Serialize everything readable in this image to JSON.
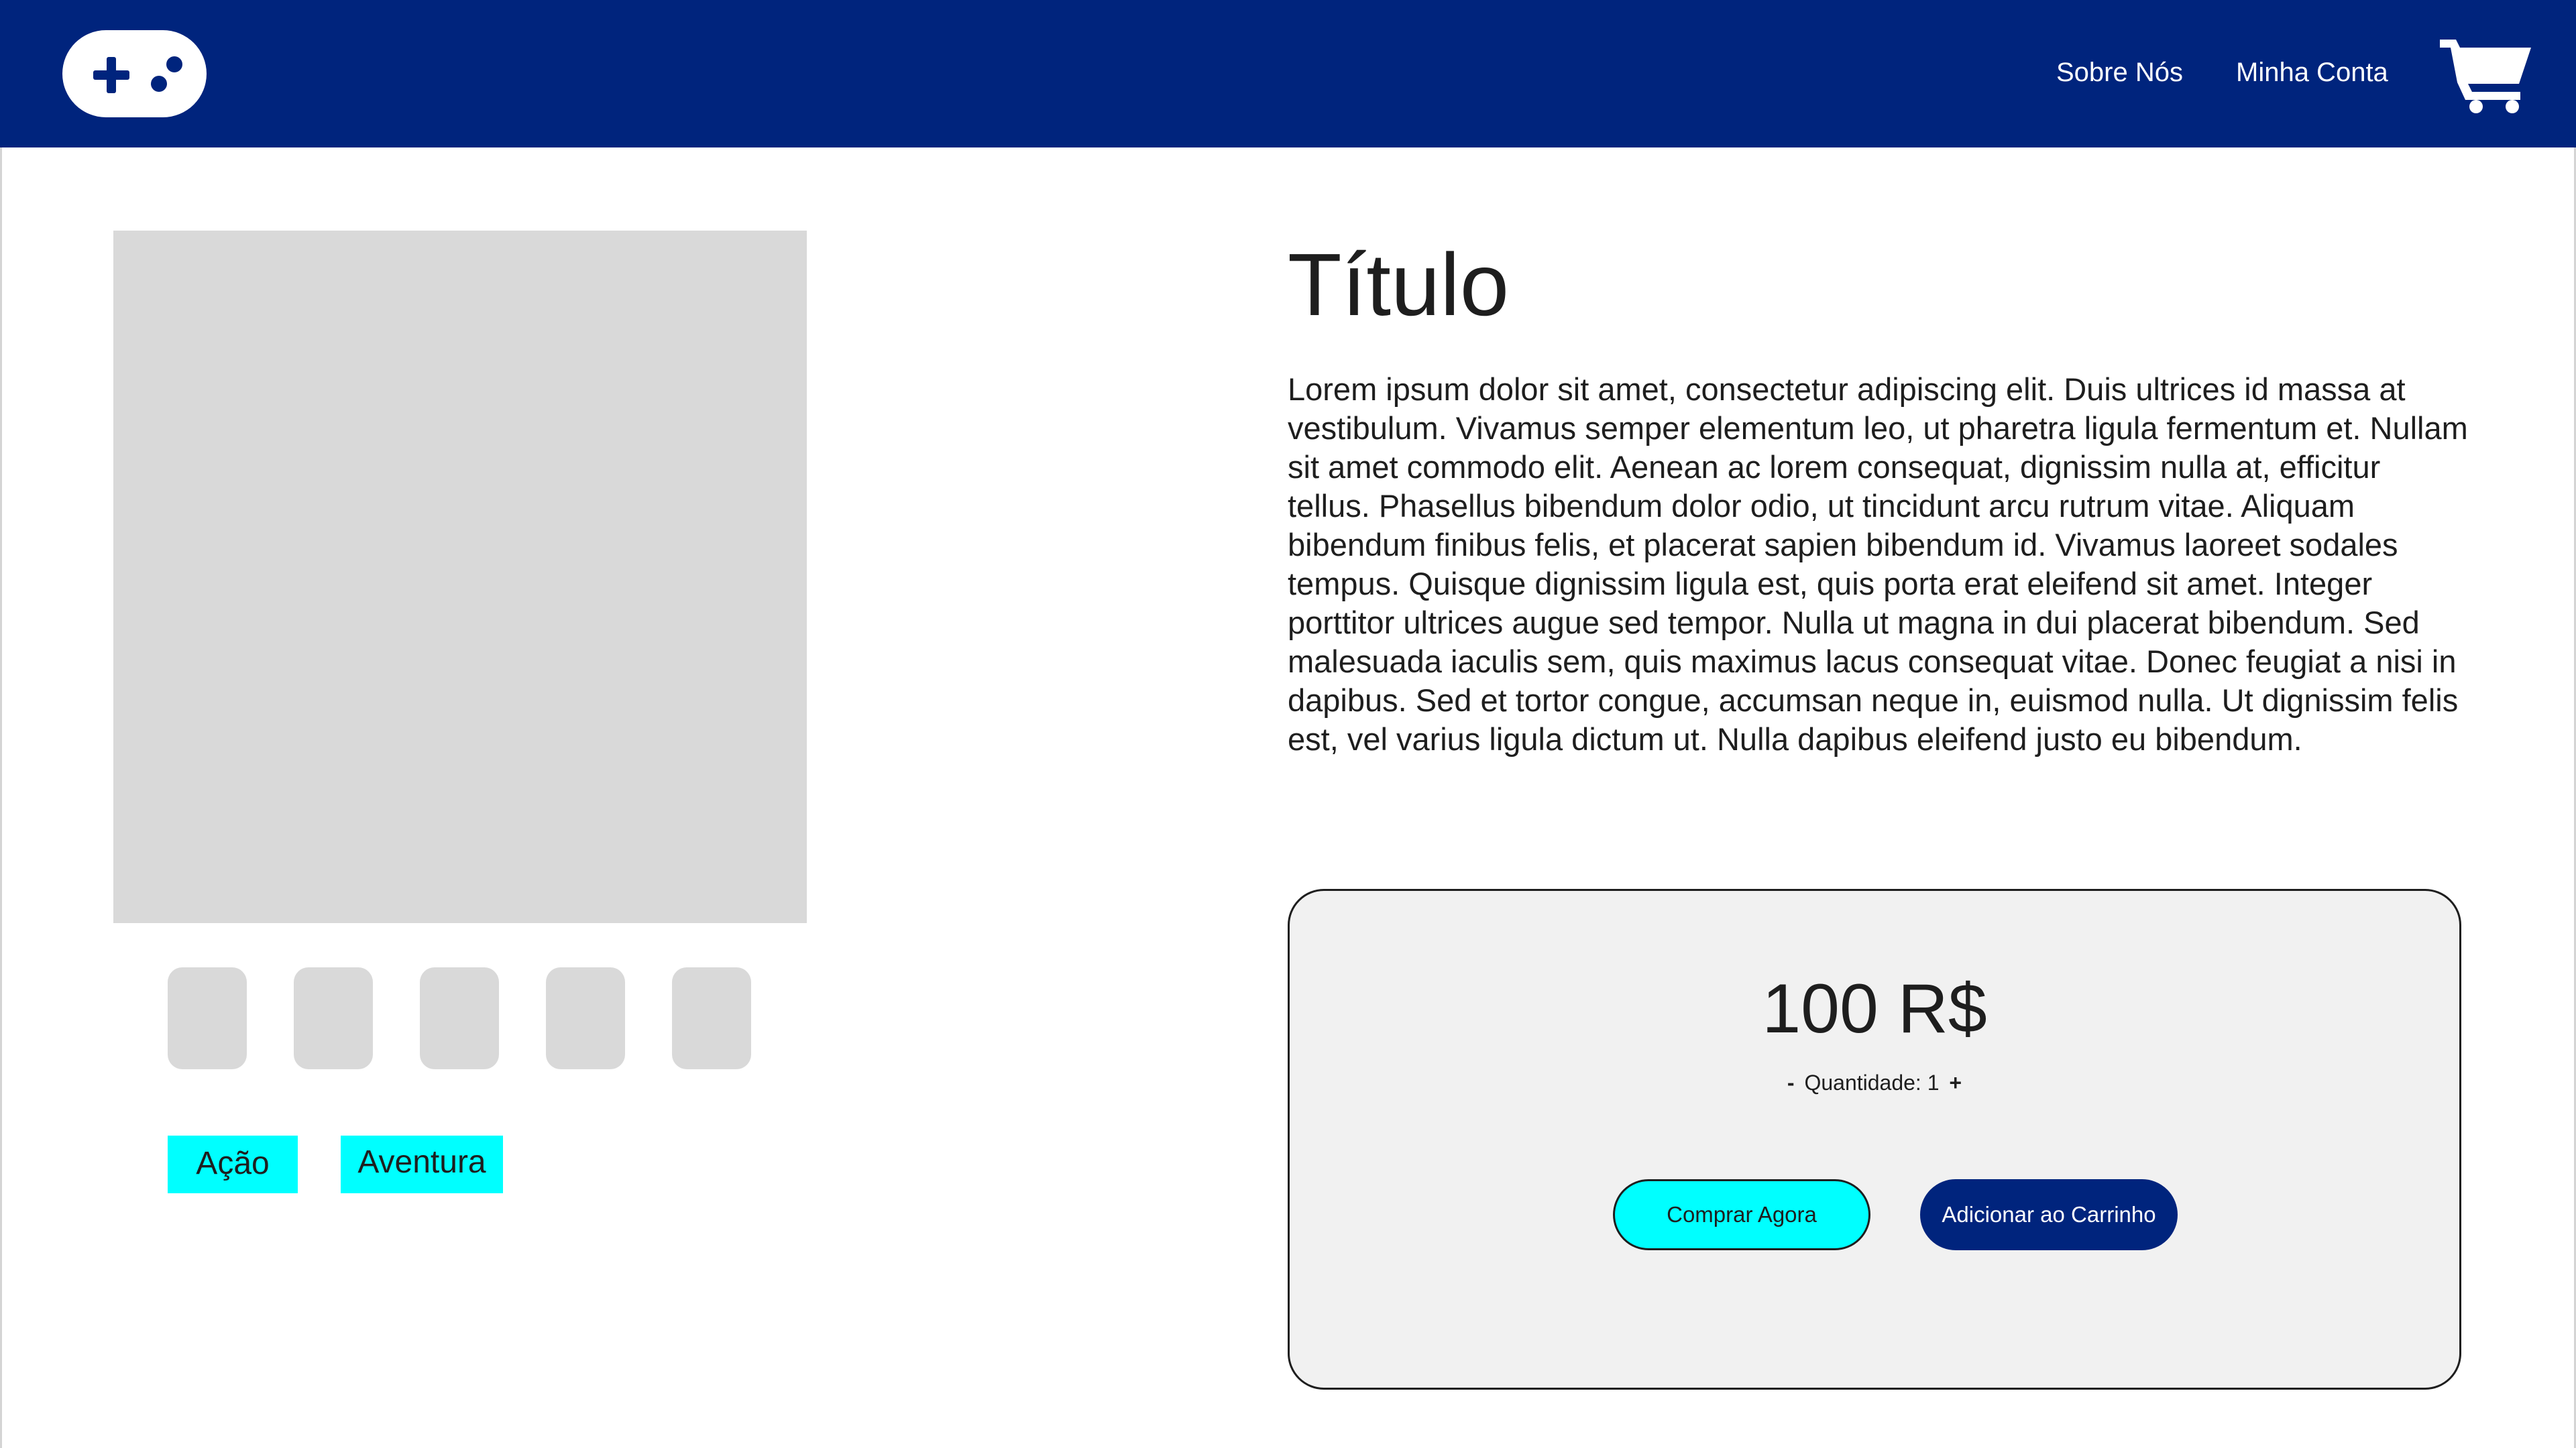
{
  "header": {
    "logo_icon": "gamepad-icon",
    "nav": {
      "about": "Sobre Nós",
      "account": "Minha Conta"
    },
    "cart_icon": "shopping-cart-icon"
  },
  "gallery": {
    "thumbnail_count": 5
  },
  "tags": [
    "Ação",
    "Aventura"
  ],
  "product": {
    "title": "Título",
    "description": "Lorem ipsum dolor sit amet, consectetur adipiscing elit. Duis ultrices id massa at vestibulum. Vivamus semper elementum leo, ut pharetra ligula fermentum et. Nullam sit amet commodo elit. Aenean ac lorem consequat, dignissim nulla at, efficitur tellus. Phasellus bibendum dolor odio, ut tincidunt arcu rutrum vitae. Aliquam bibendum finibus felis, et placerat sapien bibendum id. Vivamus laoreet sodales tempus. Quisque dignissim ligula est, quis porta erat eleifend sit amet. Integer porttitor ultrices augue sed tempor. Nulla ut magna in dui placerat bibendum. Sed malesuada iaculis sem, quis maximus lacus consequat vitae. Donec feugiat a nisi in dapibus. Sed et tortor congue, accumsan neque in, euismod nulla. Ut dignissim felis est, vel varius ligula dictum ut. Nulla dapibus eleifend justo eu bibendum."
  },
  "purchase": {
    "price": "100 R$",
    "qty_minus": "-",
    "qty_label": "Quantidade: 1",
    "qty_plus": "+",
    "buy_now": "Comprar Agora",
    "add_to_cart": "Adicionar ao Carrinho"
  },
  "colors": {
    "brand_navy": "#00247d",
    "accent_cyan": "#00ffff",
    "placeholder_gray": "#d9d9d9",
    "card_bg": "#f1f1f1"
  }
}
